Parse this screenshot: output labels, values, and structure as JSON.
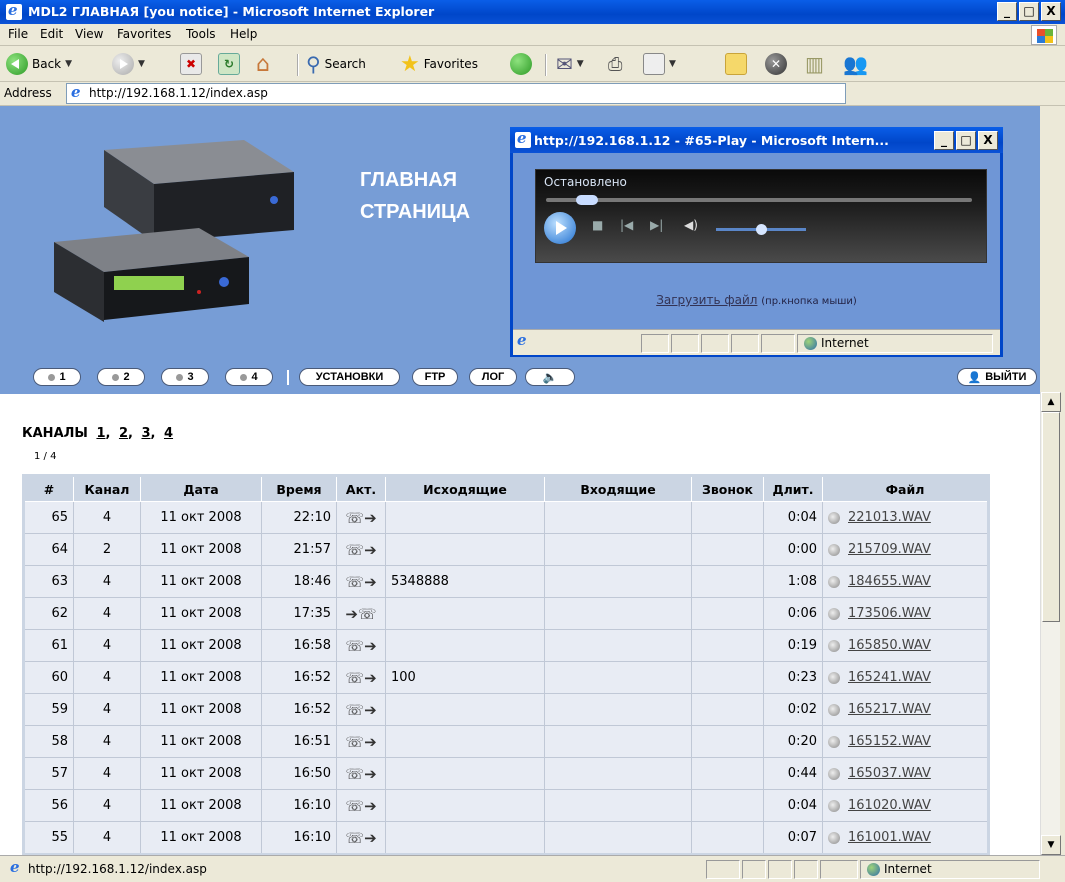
{
  "window": {
    "title": "MDL2 ГЛАВНАЯ [you notice] - Microsoft Internet Explorer",
    "min": "_",
    "max": "□",
    "close": "X"
  },
  "menu": [
    "File",
    "Edit",
    "View",
    "Favorites",
    "Tools",
    "Help"
  ],
  "toolbar": {
    "back": "Back",
    "search": "Search",
    "favorites": "Favorites"
  },
  "address": {
    "label": "Address",
    "url": "http://192.168.1.12/index.asp"
  },
  "header": {
    "title_line1": "ГЛАВНАЯ",
    "title_line2": "СТРАНИЦА",
    "nav": {
      "ch1": "1",
      "ch2": "2",
      "ch3": "3",
      "ch4": "4",
      "settings": "УСТАНОВКИ",
      "ftp": "FTP",
      "log": "ЛОГ",
      "logout": "ВЫЙТИ"
    }
  },
  "channels": {
    "label": "КАНАЛЫ",
    "links": [
      "1",
      "2",
      "3",
      "4"
    ],
    "pager": "1 / 4"
  },
  "table": {
    "headers": [
      "#",
      "Канал",
      "Дата",
      "Время",
      "Акт.",
      "Исходящие",
      "Входящие",
      "Звонок",
      "Длит.",
      "Файл"
    ],
    "rows": [
      {
        "num": "65",
        "channel": "4",
        "date": "11 окт 2008",
        "time": "22:10",
        "act": "out",
        "outgoing": "",
        "incoming": "",
        "ring": "",
        "dur": "0:04",
        "file": "221013.WAV"
      },
      {
        "num": "64",
        "channel": "2",
        "date": "11 окт 2008",
        "time": "21:57",
        "act": "out",
        "outgoing": "",
        "incoming": "",
        "ring": "",
        "dur": "0:00",
        "file": "215709.WAV"
      },
      {
        "num": "63",
        "channel": "4",
        "date": "11 окт 2008",
        "time": "18:46",
        "act": "out",
        "outgoing": "5348888",
        "incoming": "",
        "ring": "",
        "dur": "1:08",
        "file": "184655.WAV"
      },
      {
        "num": "62",
        "channel": "4",
        "date": "11 окт 2008",
        "time": "17:35",
        "act": "in",
        "outgoing": "",
        "incoming": "",
        "ring": "",
        "dur": "0:06",
        "file": "173506.WAV"
      },
      {
        "num": "61",
        "channel": "4",
        "date": "11 окт 2008",
        "time": "16:58",
        "act": "out",
        "outgoing": "",
        "incoming": "",
        "ring": "",
        "dur": "0:19",
        "file": "165850.WAV"
      },
      {
        "num": "60",
        "channel": "4",
        "date": "11 окт 2008",
        "time": "16:52",
        "act": "out",
        "outgoing": "100",
        "incoming": "",
        "ring": "",
        "dur": "0:23",
        "file": "165241.WAV"
      },
      {
        "num": "59",
        "channel": "4",
        "date": "11 окт 2008",
        "time": "16:52",
        "act": "out",
        "outgoing": "",
        "incoming": "",
        "ring": "",
        "dur": "0:02",
        "file": "165217.WAV"
      },
      {
        "num": "58",
        "channel": "4",
        "date": "11 окт 2008",
        "time": "16:51",
        "act": "out",
        "outgoing": "",
        "incoming": "",
        "ring": "",
        "dur": "0:20",
        "file": "165152.WAV"
      },
      {
        "num": "57",
        "channel": "4",
        "date": "11 окт 2008",
        "time": "16:50",
        "act": "out",
        "outgoing": "",
        "incoming": "",
        "ring": "",
        "dur": "0:44",
        "file": "165037.WAV"
      },
      {
        "num": "56",
        "channel": "4",
        "date": "11 окт 2008",
        "time": "16:10",
        "act": "out",
        "outgoing": "",
        "incoming": "",
        "ring": "",
        "dur": "0:04",
        "file": "161020.WAV"
      },
      {
        "num": "55",
        "channel": "4",
        "date": "11 окт 2008",
        "time": "16:10",
        "act": "out",
        "outgoing": "",
        "incoming": "",
        "ring": "",
        "dur": "0:07",
        "file": "161001.WAV"
      }
    ]
  },
  "status": {
    "url": "http://192.168.1.12/index.asp",
    "zone": "Internet"
  },
  "popup": {
    "title": "http://192.168.1.12 - #65-Play - Microsoft Intern...",
    "player_status": "Остановлено",
    "load_link": "Загрузить файл",
    "load_hint": "(пр.кнопка мыши)",
    "zone": "Internet"
  },
  "icons": {
    "act_out": "phone-outgoing-icon",
    "act_in": "phone-incoming-icon",
    "file": "speaker-icon"
  },
  "colors": {
    "titlebar": "#0046c9",
    "header_bg": "#779dd6",
    "table_header": "#cbd5e3",
    "table_cell": "#e8ecf4"
  }
}
